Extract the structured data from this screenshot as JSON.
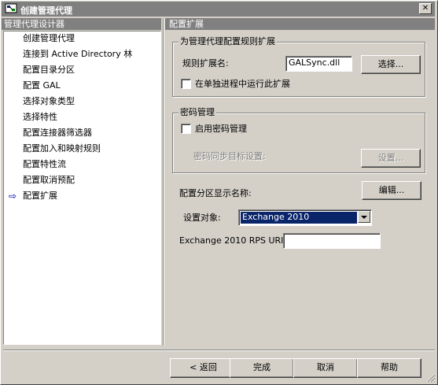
{
  "window": {
    "title": "创建管理代理",
    "close_glyph": "✕"
  },
  "left_panel": {
    "header": "管理代理设计器",
    "current_arrow": "⇨",
    "items": [
      {
        "label": "创建管理代理"
      },
      {
        "label": "连接到 Active Directory 林"
      },
      {
        "label": "配置目录分区"
      },
      {
        "label": "配置 GAL"
      },
      {
        "label": "选择对象类型"
      },
      {
        "label": "选择特性"
      },
      {
        "label": "配置连接器筛选器"
      },
      {
        "label": "配置加入和映射规则"
      },
      {
        "label": "配置特性流"
      },
      {
        "label": "配置取消预配"
      },
      {
        "label": "配置扩展"
      }
    ]
  },
  "right_panel": {
    "header": "配置扩展",
    "rules_group": {
      "title": "为管理代理配置规则扩展",
      "name_label": "规则扩展名:",
      "name_value": "GALSync.dll",
      "browse_button": "选择...",
      "separate_process_label": "在单独进程中运行此扩展"
    },
    "password_group": {
      "title": "密码管理",
      "enable_label": "启用密码管理",
      "target_label": "密码同步目标设置:",
      "settings_button": "设置..."
    },
    "partition_label": "配置分区显示名称:",
    "edit_button": "编辑...",
    "target_label": "设置对象:",
    "target_value": "Exchange 2010",
    "rps_label": "Exchange 2010 RPS URI:",
    "rps_value": ""
  },
  "footer": {
    "back_button": "< 返回",
    "finish_button": "完成",
    "cancel_button": "取消",
    "help_button": "帮助"
  }
}
